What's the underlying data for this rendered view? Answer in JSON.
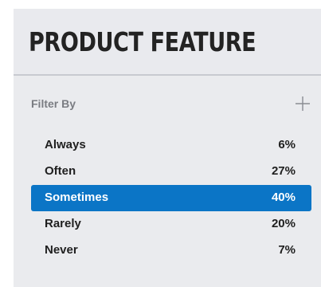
{
  "panel": {
    "title": "PRODUCT FEATURE",
    "filter_label": "Filter By",
    "add_icon": "plus-icon"
  },
  "colors": {
    "panel_bg": "#eaebee",
    "selected_bg": "#0b75c6",
    "text": "#1f1f1f",
    "muted": "#7a7c82"
  },
  "items": [
    {
      "label": "Always",
      "value": "6%",
      "selected": false
    },
    {
      "label": "Often",
      "value": "27%",
      "selected": false
    },
    {
      "label": "Sometimes",
      "value": "40%",
      "selected": true
    },
    {
      "label": "Rarely",
      "value": "20%",
      "selected": false
    },
    {
      "label": "Never",
      "value": "7%",
      "selected": false
    }
  ]
}
